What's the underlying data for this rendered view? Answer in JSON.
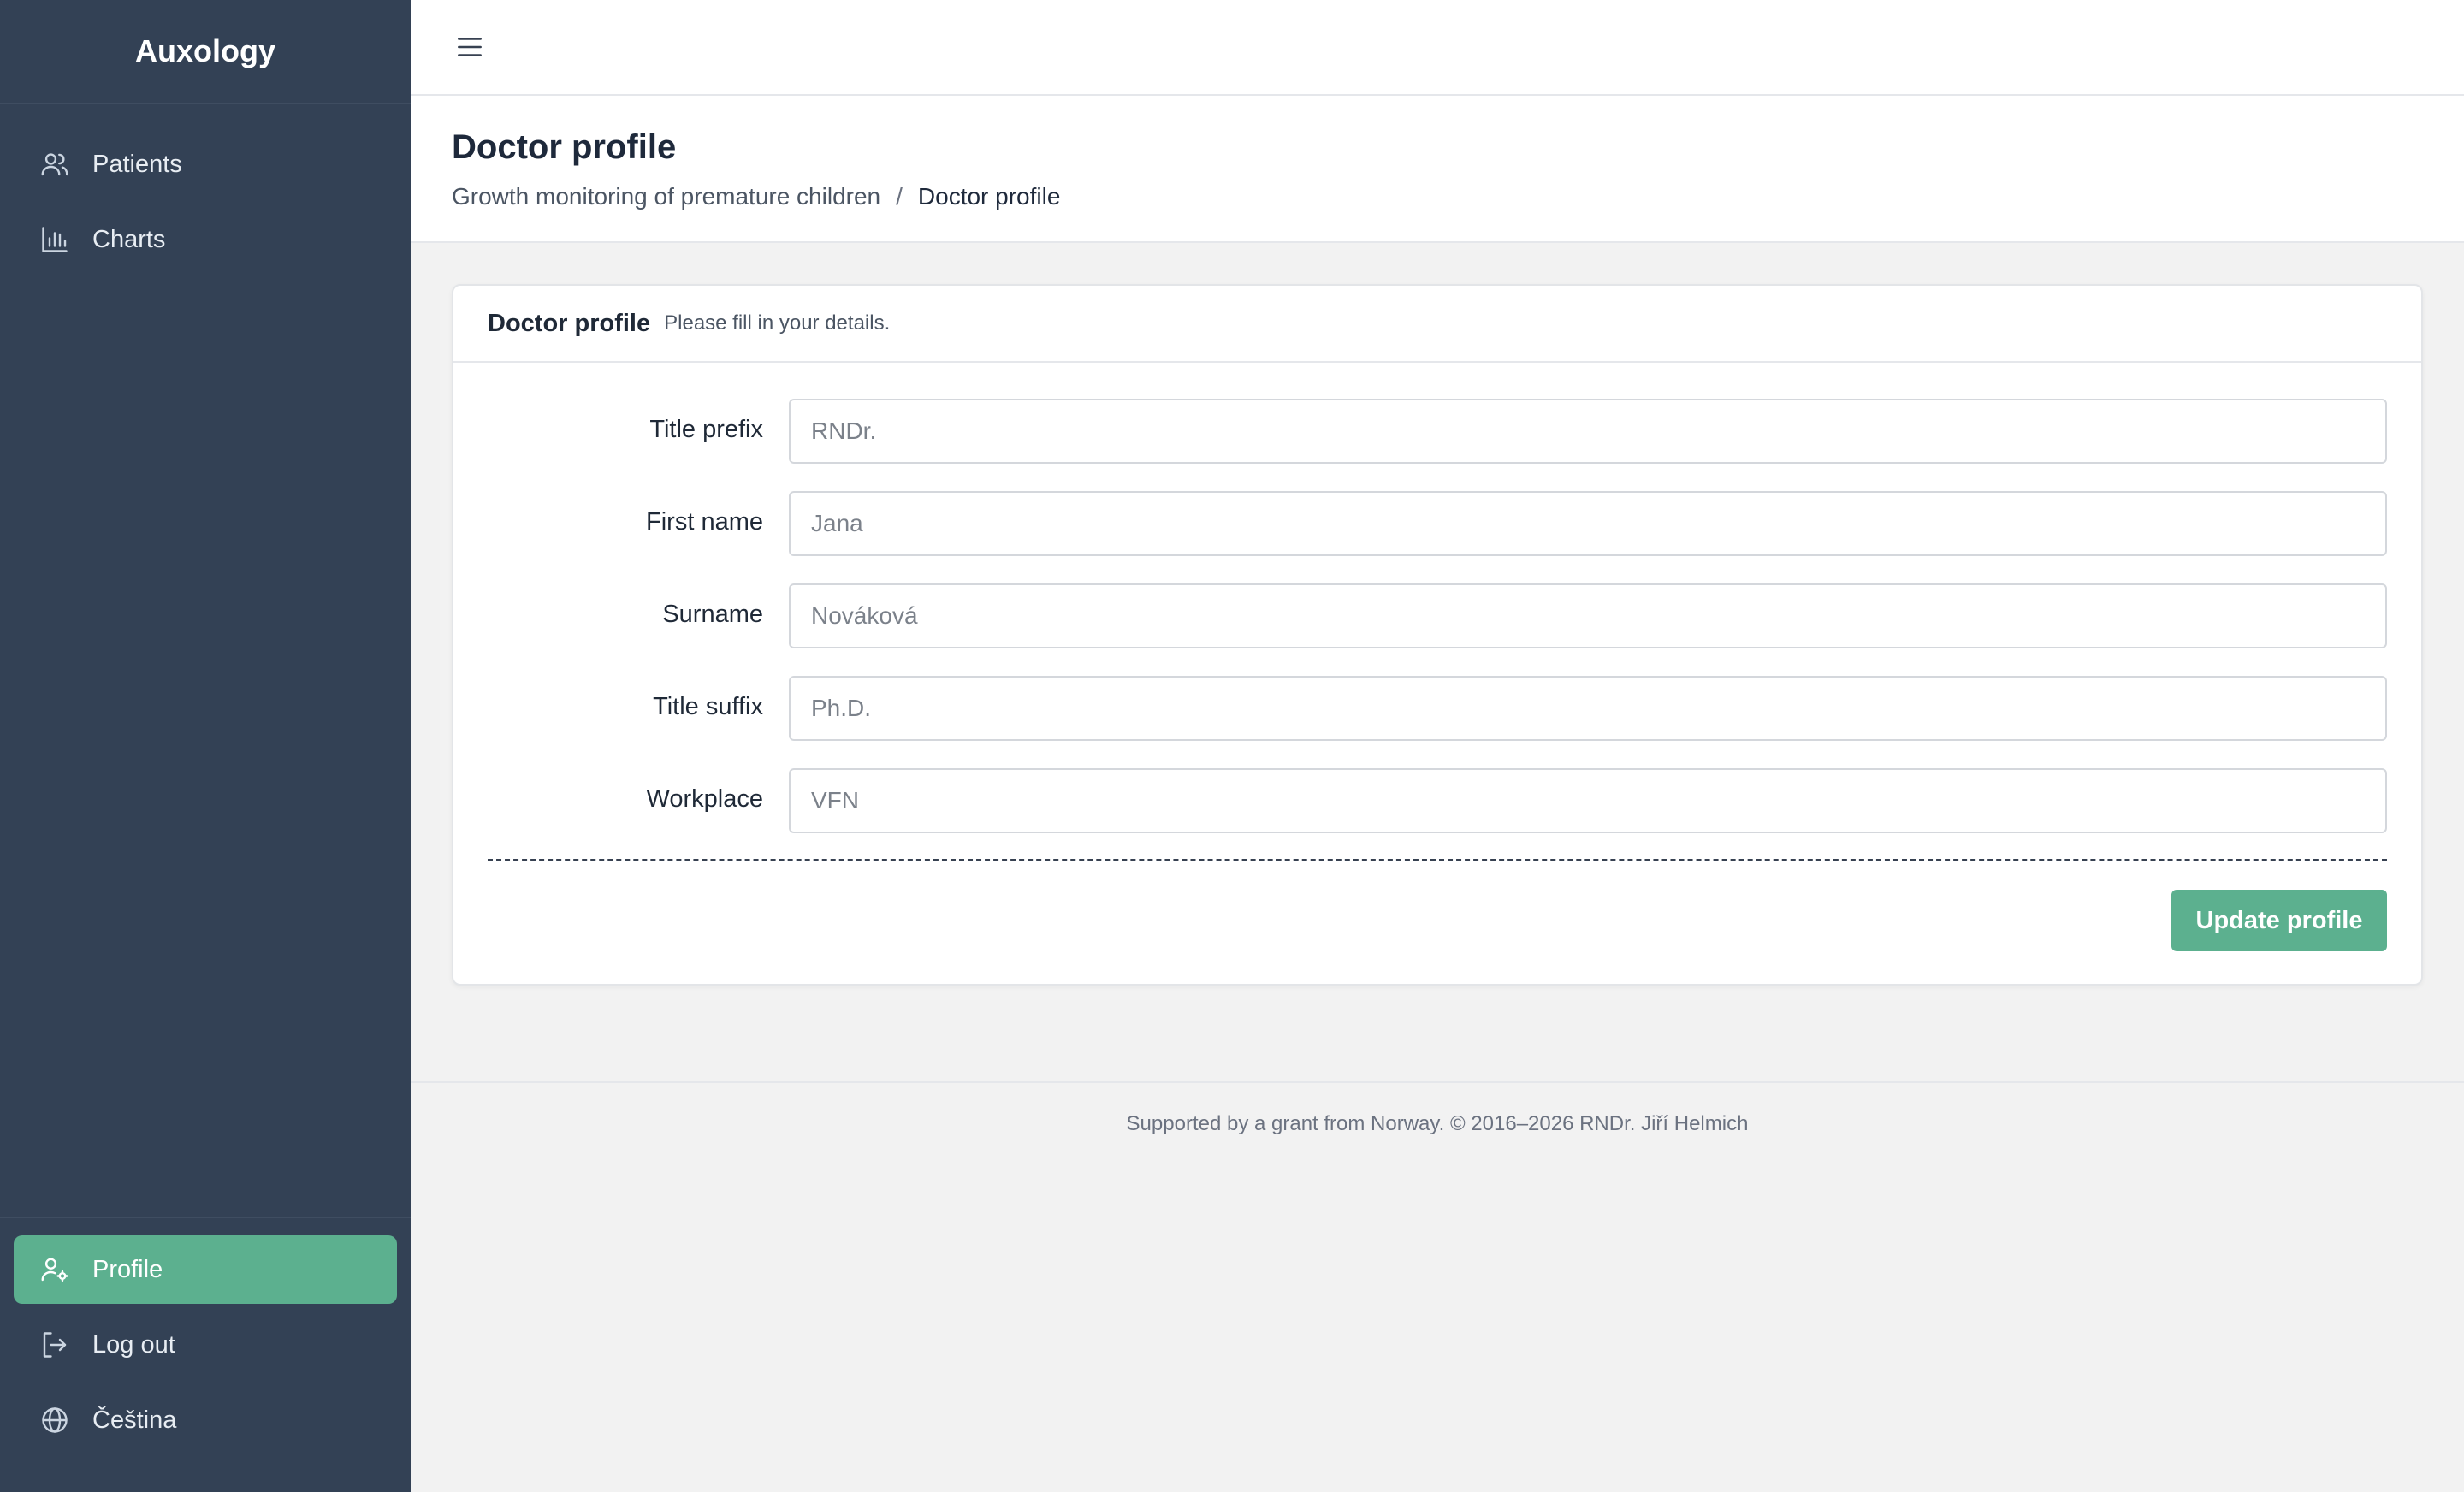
{
  "app": {
    "title": "Auxology"
  },
  "sidebar": {
    "items": [
      {
        "label": "Patients",
        "icon": "users-icon"
      },
      {
        "label": "Charts",
        "icon": "bar-chart-icon"
      }
    ],
    "bottom_items": [
      {
        "label": "Profile",
        "icon": "user-settings-icon",
        "active": true
      },
      {
        "label": "Log out",
        "icon": "logout-icon"
      },
      {
        "label": "Čeština",
        "icon": "globe-icon"
      }
    ]
  },
  "header": {
    "title": "Doctor profile",
    "breadcrumb": {
      "parent": "Growth monitoring of premature children",
      "separator": "/",
      "current": "Doctor profile"
    }
  },
  "card": {
    "title": "Doctor profile",
    "subtitle": "Please fill in your details."
  },
  "form": {
    "fields": [
      {
        "label": "Title prefix",
        "placeholder": "RNDr.",
        "value": ""
      },
      {
        "label": "First name",
        "placeholder": "Jana",
        "value": ""
      },
      {
        "label": "Surname",
        "placeholder": "Nováková",
        "value": ""
      },
      {
        "label": "Title suffix",
        "placeholder": "Ph.D.",
        "value": ""
      },
      {
        "label": "Workplace",
        "placeholder": "VFN",
        "value": ""
      }
    ],
    "submit_label": "Update profile"
  },
  "footer": {
    "text": "Supported by a grant from Norway. © 2016–2026 RNDr. Jiří Helmich"
  },
  "colors": {
    "sidebar_bg": "#334155",
    "accent": "#5cb08f",
    "page_bg": "#f2f2f2"
  }
}
